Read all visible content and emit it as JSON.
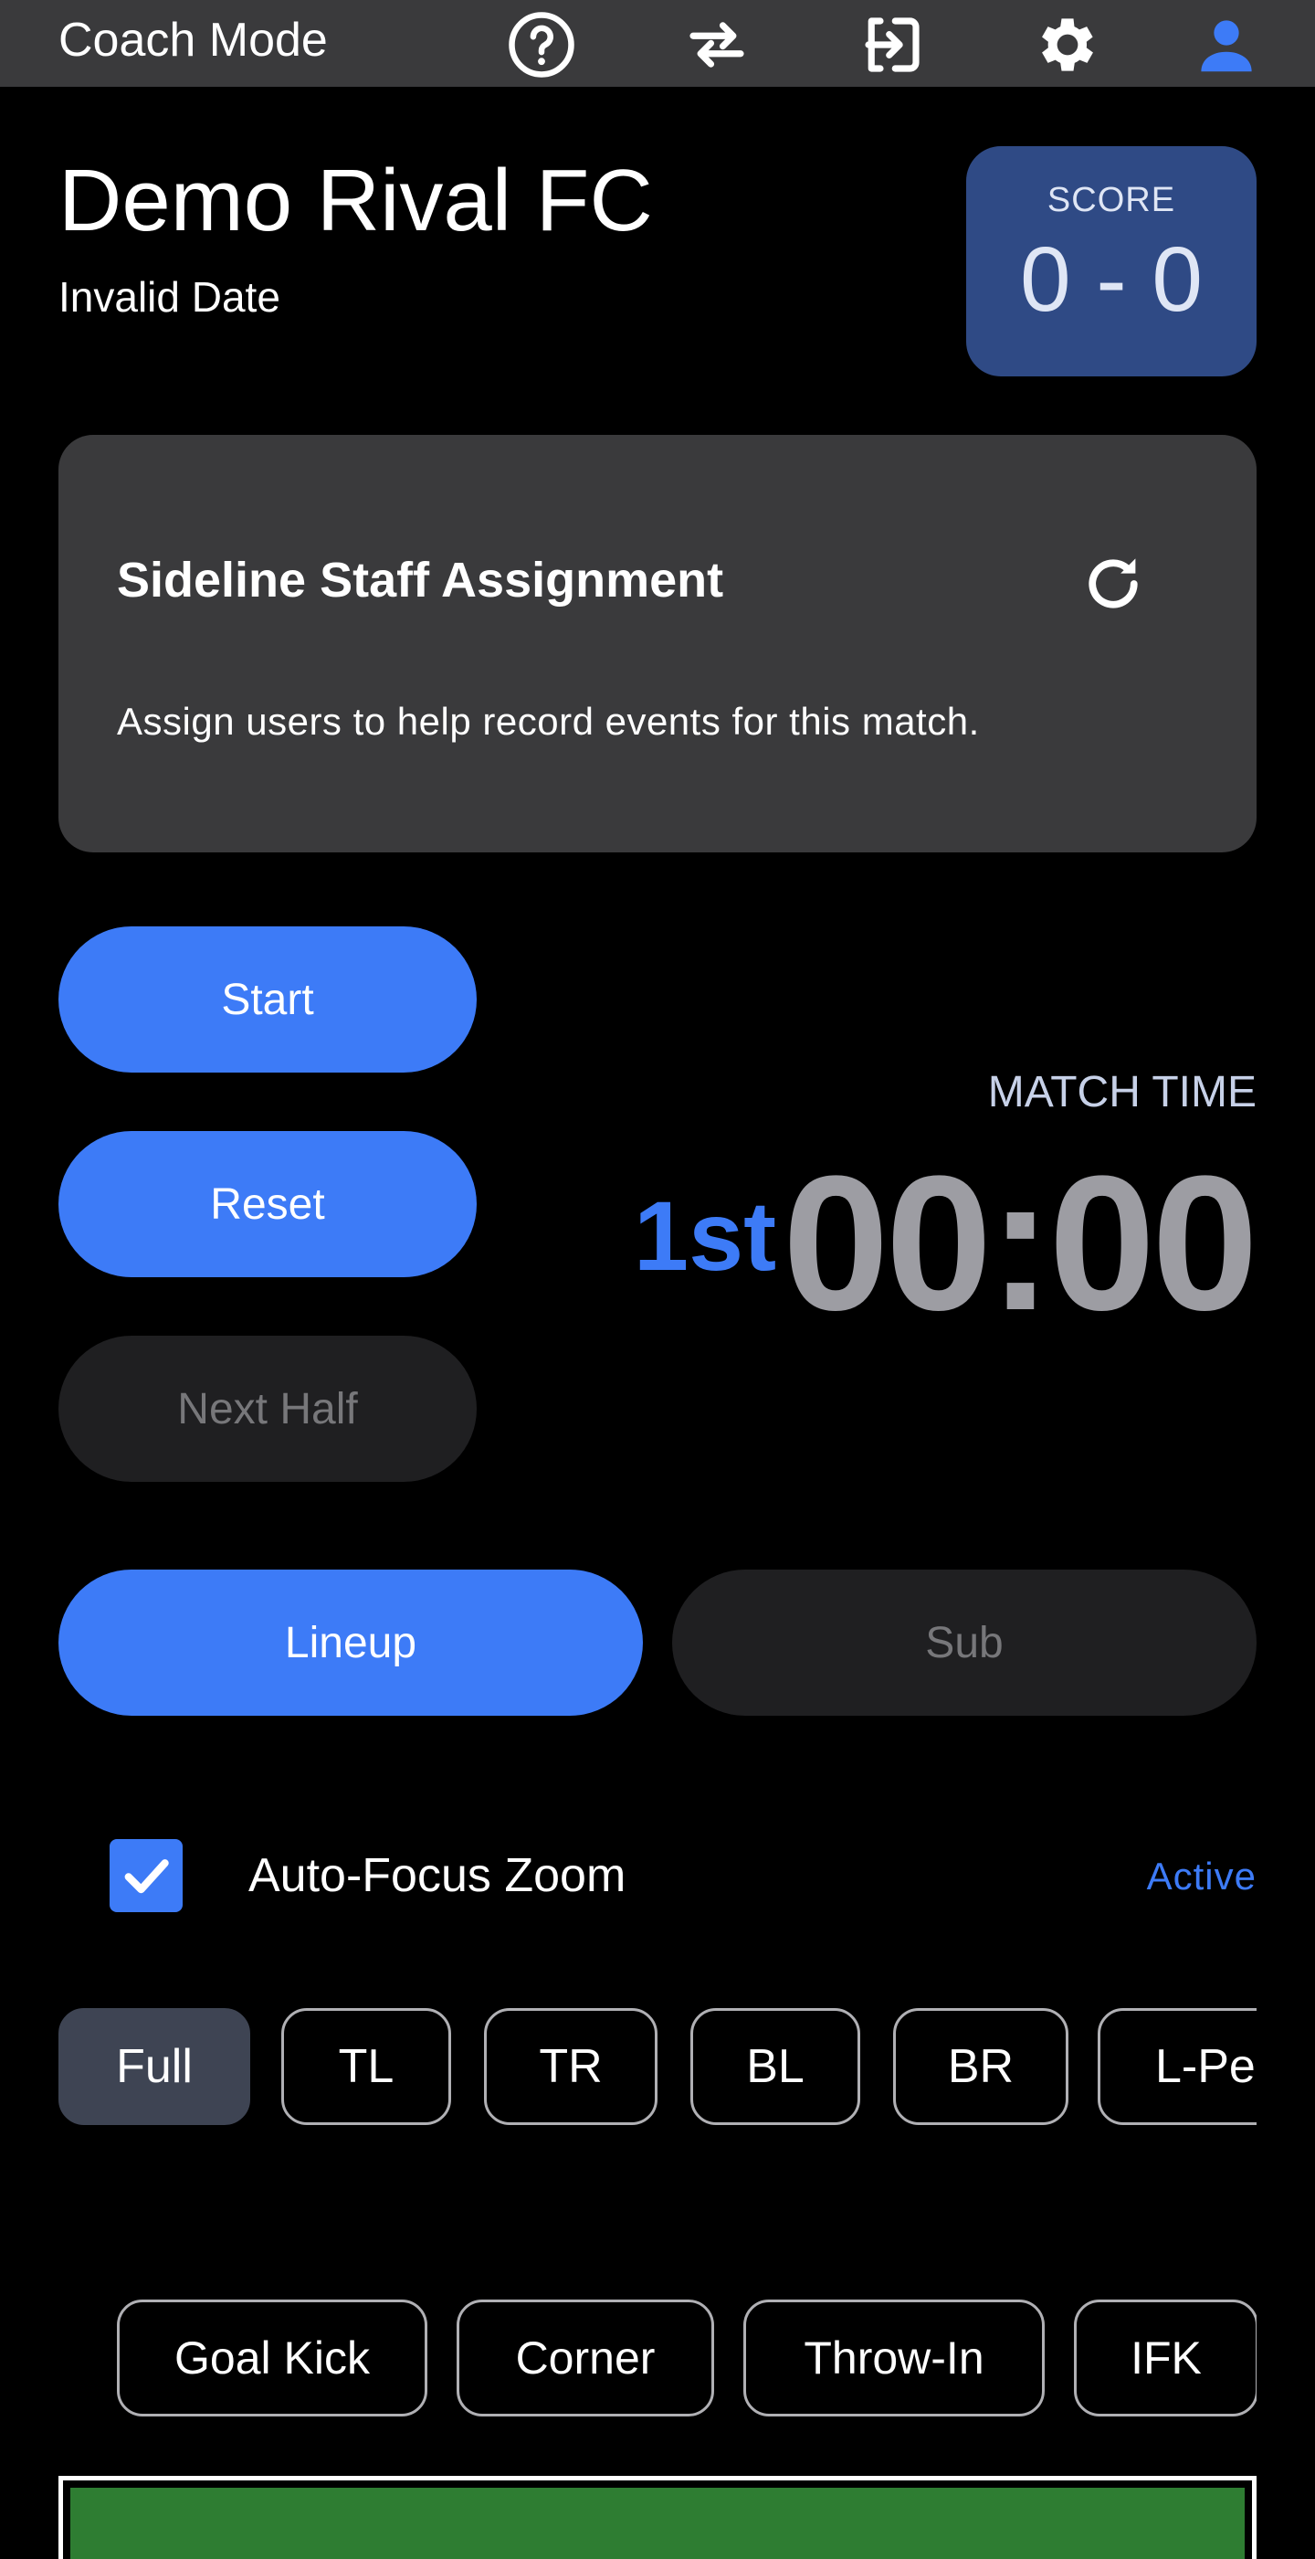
{
  "topbar": {
    "title": "Coach Mode",
    "icons": [
      "help-icon",
      "swap-icon",
      "exit-icon",
      "settings-icon",
      "account-icon"
    ]
  },
  "match": {
    "opponent": "Demo Rival FC",
    "date": "Invalid Date"
  },
  "score": {
    "label": "SCORE",
    "value": "0 - 0"
  },
  "staff": {
    "title": "Sideline Staff Assignment",
    "description": "Assign users to help record events for this match.",
    "refresh_icon": "refresh-icon"
  },
  "controls": {
    "start": "Start",
    "reset": "Reset",
    "next_half": "Next Half"
  },
  "match_time": {
    "label": "MATCH TIME",
    "half": "1st",
    "clock": "00:00"
  },
  "tabs": {
    "lineup": "Lineup",
    "sub": "Sub"
  },
  "auto_focus": {
    "label": "Auto-Focus Zoom",
    "status": "Active",
    "checked": true
  },
  "zoom": {
    "selected": "Full",
    "options": [
      "Full",
      "TL",
      "TR",
      "BL",
      "BR",
      "L-Pen"
    ]
  },
  "events": {
    "options": [
      "Goal Kick",
      "Corner",
      "Throw-In",
      "IFK"
    ]
  },
  "colors": {
    "accent": "#3d7bf7",
    "topbar": "#3a3a3c",
    "card": "#3a3a3c",
    "score_bg": "#2f4a85",
    "disabled_bg": "#1f1f21",
    "pitch": "#2e7d32"
  }
}
